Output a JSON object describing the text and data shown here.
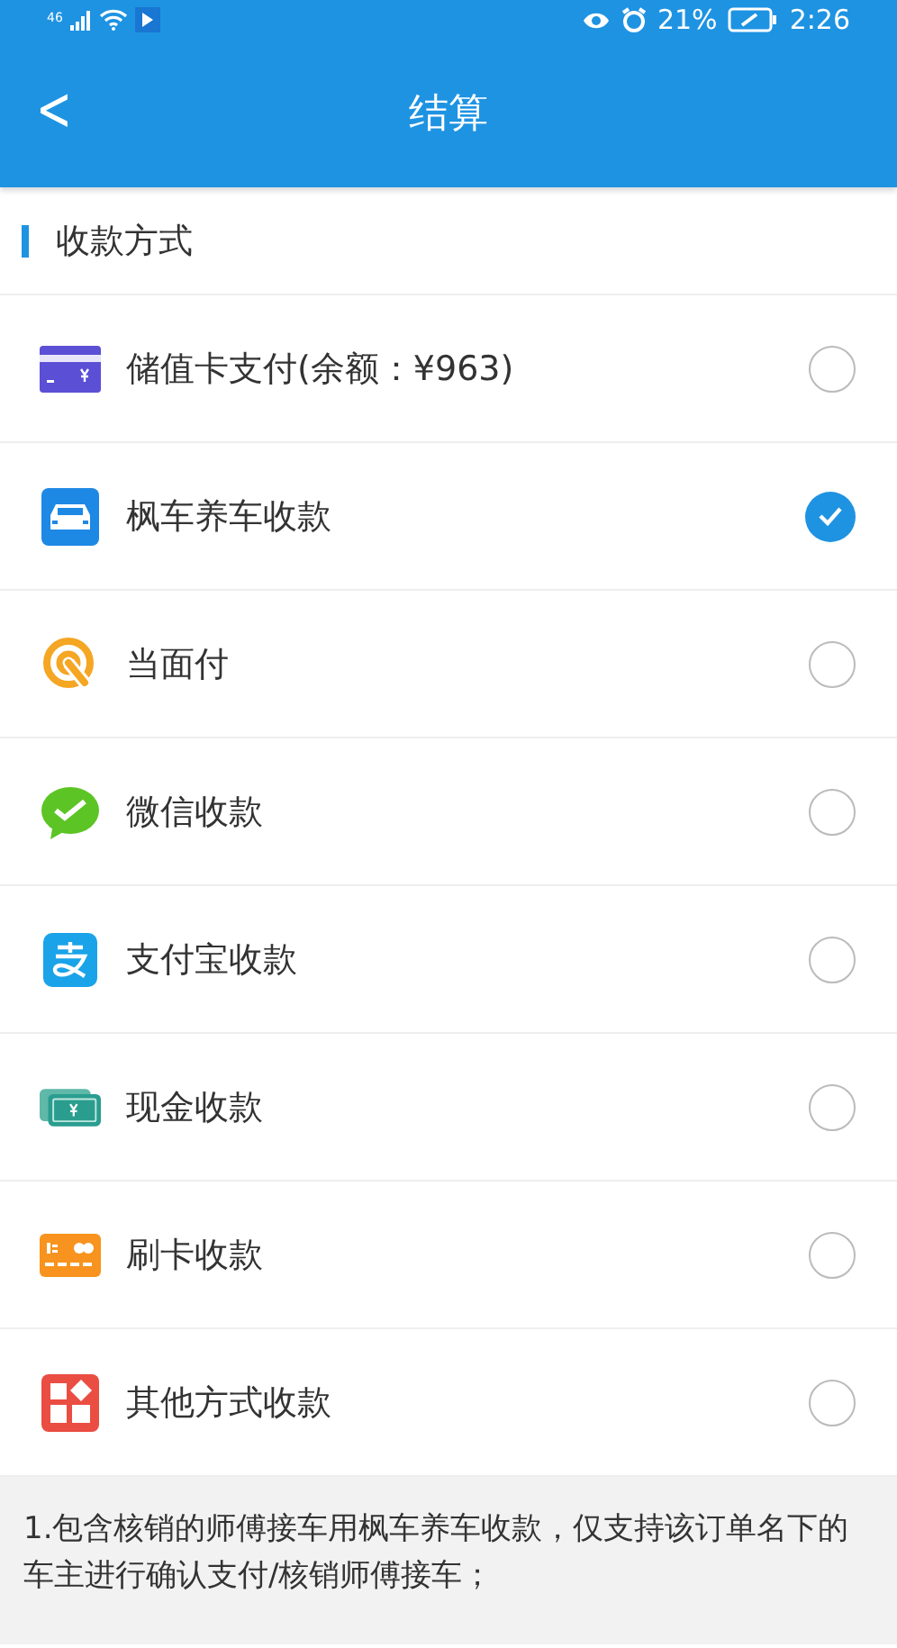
{
  "status_bar": {
    "network": "46",
    "battery": "21%",
    "time": "2:26"
  },
  "header": {
    "back": "<",
    "title": "结算"
  },
  "section": {
    "title": "收款方式"
  },
  "methods": [
    {
      "kind": "card",
      "label": "储值卡支付(余额：¥963)",
      "selected": false
    },
    {
      "kind": "car",
      "label": "枫车养车收款",
      "selected": true
    },
    {
      "kind": "facepay",
      "label": "当面付",
      "selected": false
    },
    {
      "kind": "wechat",
      "label": "微信收款",
      "selected": false
    },
    {
      "kind": "alipay",
      "label": "支付宝收款",
      "selected": false
    },
    {
      "kind": "cash",
      "label": "现金收款",
      "selected": false
    },
    {
      "kind": "swipe",
      "label": "刷卡收款",
      "selected": false
    },
    {
      "kind": "other",
      "label": "其他方式收款",
      "selected": false
    }
  ],
  "note": {
    "text": "1.包含核销的师傅接车用枫车养车收款，仅支持该订单名下的车主进行确认支付/核销师傅接车；"
  }
}
